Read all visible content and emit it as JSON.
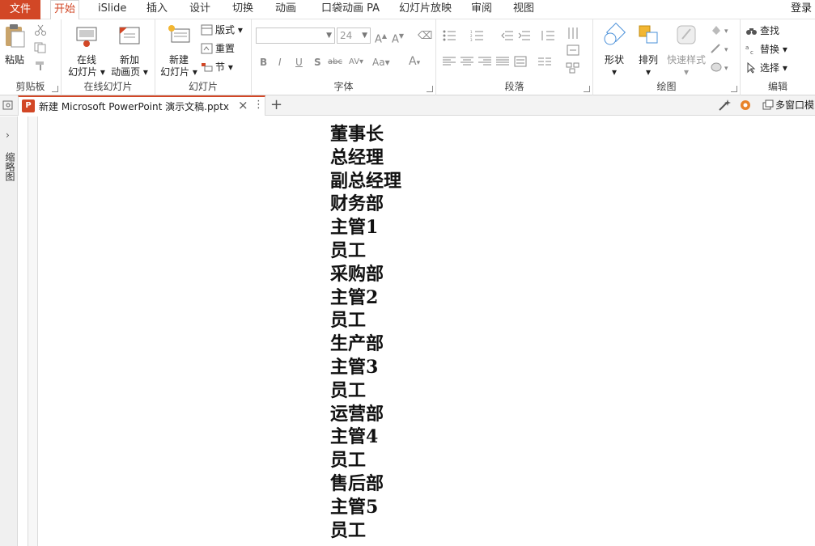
{
  "menubar": {
    "file": "文件",
    "tabs": [
      "开始",
      "iSlide",
      "插入",
      "设计",
      "切换",
      "动画",
      "口袋动画 PA",
      "幻灯片放映",
      "审阅",
      "视图"
    ],
    "login": "登录"
  },
  "ribbon": {
    "clipboard": {
      "label": "剪贴板",
      "paste": "粘贴"
    },
    "online": {
      "label": "在线幻灯片",
      "online_slides": [
        "在线",
        "幻灯片"
      ],
      "new_anim_page": [
        "新加",
        "动画页"
      ]
    },
    "slides": {
      "label": "幻灯片",
      "new_slide": [
        "新建",
        "幻灯片"
      ],
      "layout": "版式",
      "reset": "重置",
      "section": "节"
    },
    "font": {
      "label": "字体",
      "font_name": "",
      "font_size": "24",
      "bold": "B",
      "italic": "I",
      "underline": "U",
      "shadow": "S",
      "strike": "abc",
      "spacing": "AV",
      "case": "Aa",
      "color": "A"
    },
    "paragraph": {
      "label": "段落"
    },
    "drawing": {
      "label": "绘图",
      "shape": "形状",
      "arrange": "排列",
      "quick_styles": "快速样式"
    },
    "editing": {
      "label": "编辑",
      "find": "查找",
      "replace": "替换",
      "select": "选择"
    }
  },
  "doctabs": {
    "title": "新建 Microsoft PowerPoint 演示文稿.pptx",
    "multi_window": "多窗口模"
  },
  "sidepanel": {
    "label": "缩略图"
  },
  "outline": {
    "items": [
      "董事长",
      "总经理",
      "副总经理",
      "财务部",
      "主管1",
      "员工",
      "采购部",
      "主管2",
      "员工",
      "生产部",
      "主管3",
      "员工",
      "运营部",
      "主管4",
      "员工",
      "售后部",
      "主管5",
      "员工"
    ]
  },
  "colors": {
    "accent": "#d24726",
    "tab_bg": "#f3f3f3",
    "ribbon_bg": "#ffffff"
  }
}
